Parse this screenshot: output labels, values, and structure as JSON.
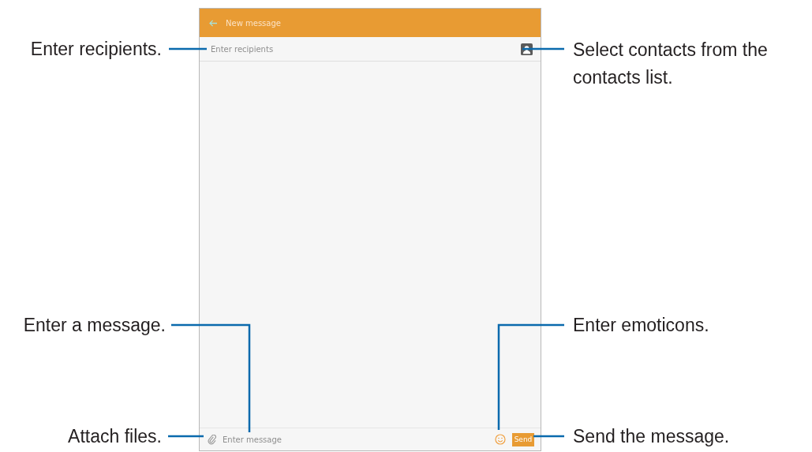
{
  "screen": {
    "header": {
      "title": "New message"
    },
    "recipients": {
      "placeholder": "Enter recipients"
    },
    "composer": {
      "placeholder": "Enter message",
      "send_button": "Send"
    }
  },
  "callouts": [
    {
      "text": "Enter recipients."
    },
    {
      "text": "Select contacts from the contacts list."
    },
    {
      "text": "Enter a message."
    },
    {
      "text": "Enter emoticons."
    },
    {
      "text": "Attach files."
    },
    {
      "text": "Send the message."
    }
  ]
}
